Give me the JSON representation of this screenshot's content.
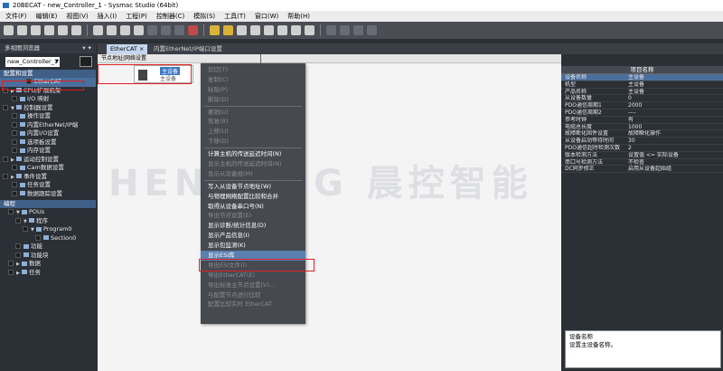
{
  "title": "20BECAT - new_Controller_1 - Sysmac Studio (64bit)",
  "menu": [
    "文件(F)",
    "编辑(E)",
    "视图(V)",
    "插入(I)",
    "工程(P)",
    "控制器(C)",
    "模拟(S)",
    "工具(T)",
    "窗口(W)",
    "帮助(H)"
  ],
  "left": {
    "header": "多视图浏览器",
    "pin": "▾ ✦",
    "controller": "new_Controller_1",
    "config_section": "配置和设置",
    "program_section": "编程",
    "config_items": [
      "EtherCAT",
      "CPU/扩展机架",
      "I/O 映射",
      "控制器设置",
      "操作设置",
      "内置EtherNet/IP端",
      "内置I/O设置",
      "选项板设置",
      "内存设置",
      "运动控制设置",
      "Cam数据设置",
      "事件设置",
      "任务设置",
      "数据跟踪设置"
    ],
    "program_items": [
      "POUs",
      "程序",
      "Program0",
      "Section0",
      "功能",
      "功能块",
      "数据",
      "任务"
    ]
  },
  "tabs": [
    "EtherCAT ×",
    "内置EtherNet/IP端口设置"
  ],
  "canvas": {
    "nodebar": "节点地址|网络设置",
    "device_label": "主设备",
    "device_sub": "主设备"
  },
  "context_menu": [
    "剪切(T)",
    "复制(C)",
    "粘贴(P)",
    "删除(D)",
    "撤销(U)",
    "恢复(R)",
    "上移(U)",
    "下移(D)",
    "计算主机的传送延迟时间(N)",
    "显示主机的传送延迟时间(N)",
    "显示从设备组(M)",
    "写入从设备节点地址(W)",
    "与物理网络配置比较和合并",
    "取得从设备串口号(N)",
    "导出节点设置(E)",
    "显示诊断/统计信息(D)",
    "显示产品信息(I)",
    "显示包监测(K)",
    "显示ESI库",
    "导出ESI文件(I)",
    "导出EtherCAT(E)",
    "导出标准主节点设置(V)...",
    "与配置节点进行比较",
    "配置比较实时 EtherCAT"
  ],
  "props": {
    "title": "项目名称",
    "rows": [
      [
        "设备名称",
        "主设备"
      ],
      [
        "机型",
        "主设备"
      ],
      [
        "产品名称",
        "主设备"
      ],
      [
        "从设备数量",
        "0"
      ],
      [
        "PDO通信周期1",
        "2000"
      ],
      [
        "PDO通信周期2",
        "----"
      ],
      [
        "参考时钟",
        "有"
      ],
      [
        "电缆总长度",
        "1000"
      ],
      [
        "故障断化固件设置",
        "故障瞬化操作"
      ],
      [
        "从设备启动等待时间",
        "30"
      ],
      [
        "PDO通信超时检测次数",
        "2"
      ],
      [
        "版本检测方法",
        "设置值 <= 实际设备"
      ],
      [
        "串口号检测方法",
        "不检查"
      ],
      [
        "DC同步修正",
        "启用从设备起始组"
      ]
    ]
  },
  "description": {
    "title": "设备名称",
    "text": "设置主设备名称。"
  },
  "watermark": "HENKONG 晨控智能"
}
